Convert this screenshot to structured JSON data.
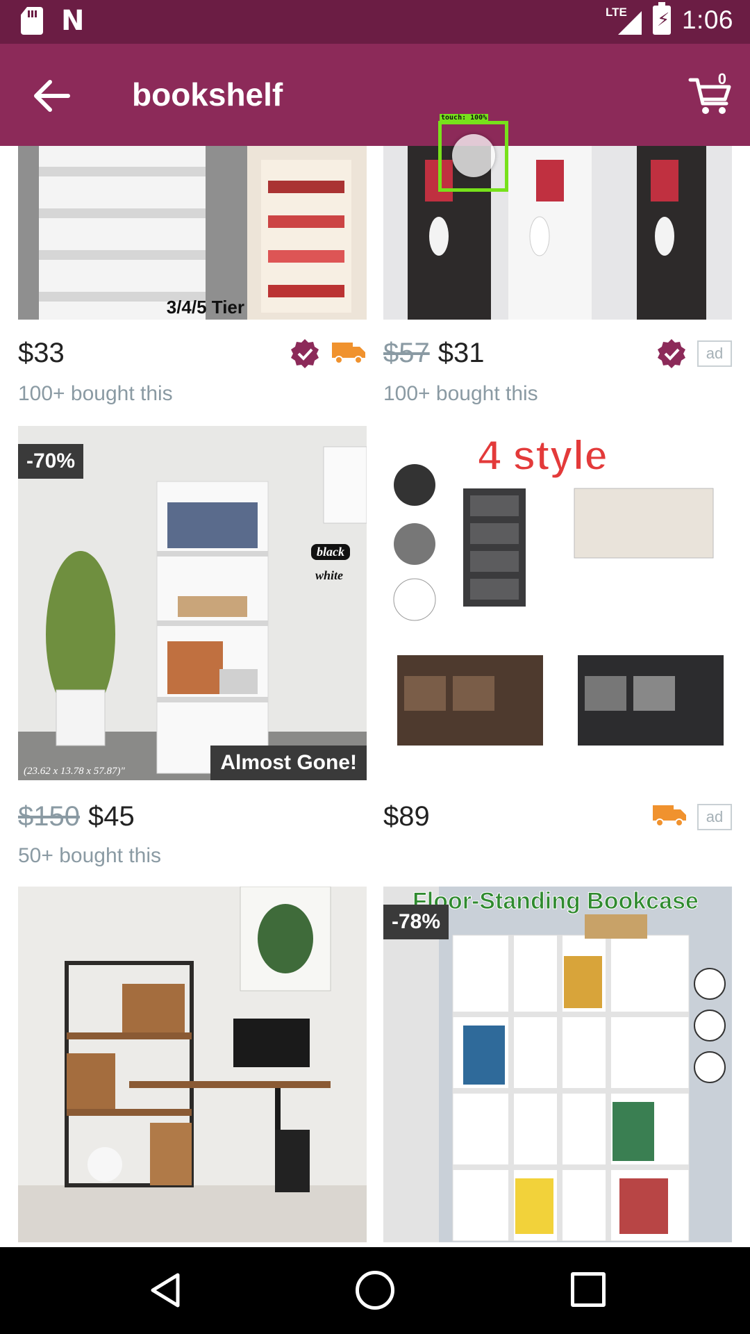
{
  "status_bar": {
    "time": "1:06",
    "network": "LTE"
  },
  "app_bar": {
    "title": "bookshelf",
    "cart_count": "0"
  },
  "touch_indicator": {
    "label": "touch: 100%"
  },
  "products": [
    {
      "price": "$33",
      "bought": "100+ bought this",
      "image_caption": "3/4/5 Tier",
      "verified": true,
      "free_shipping": true
    },
    {
      "old_price": "$57",
      "price": "$31",
      "bought": "100+ bought this",
      "verified": true,
      "ad": "ad"
    },
    {
      "old_price": "$150",
      "price": "$45",
      "bought": "50+ bought this",
      "discount": "-70%",
      "status": "Almost Gone!",
      "image_caption": "(23.62 x 13.78 x 57.87)\"",
      "image_tags": [
        "black",
        "white"
      ]
    },
    {
      "price": "$89",
      "image_caption": "4 style",
      "free_shipping": true,
      "ad": "ad"
    },
    {},
    {
      "discount": "-78%",
      "image_caption": "Floor-Standing Bookcase"
    }
  ],
  "colors": {
    "status_bar": "#6b1d44",
    "app_bar": "#8c2a59",
    "verified": "#8c2a59",
    "shipping": "#f0922e"
  }
}
